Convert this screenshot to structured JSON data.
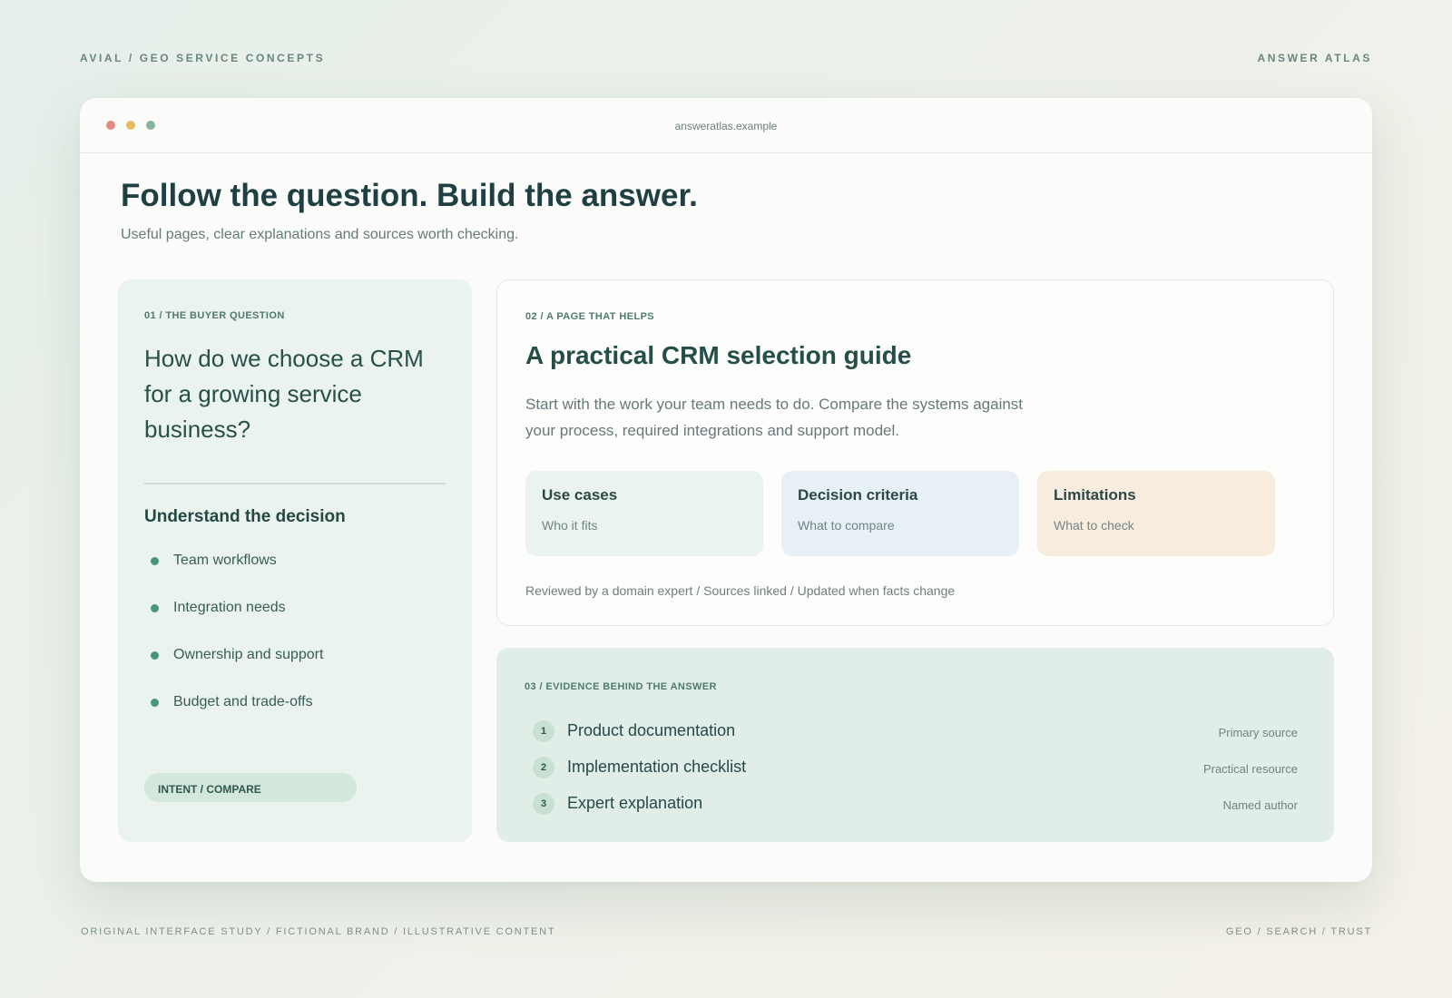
{
  "page": {
    "top_left": "AVIAL / GEO SERVICE CONCEPTS",
    "top_right": "ANSWER ATLAS",
    "bottom_left": "ORIGINAL INTERFACE STUDY / FICTIONAL BRAND / ILLUSTRATIVE CONTENT",
    "bottom_right": "GEO / SEARCH / TRUST"
  },
  "window": {
    "url": "answeratlas.example"
  },
  "hero": {
    "title": "Follow the question. Build the answer.",
    "subtitle": "Useful pages, clear explanations and sources worth checking."
  },
  "question_panel": {
    "eyebrow": "01 / THE BUYER QUESTION",
    "question": "How do we choose a CRM for a growing service business?",
    "section_title": "Understand the decision",
    "items": [
      {
        "label": "Team workflows"
      },
      {
        "label": "Integration needs"
      },
      {
        "label": "Ownership and support"
      },
      {
        "label": "Budget and trade-offs"
      }
    ],
    "pill": "INTENT / COMPARE"
  },
  "guide_panel": {
    "eyebrow": "02 / A PAGE THAT HELPS",
    "title": "A practical CRM selection guide",
    "description": "Start with the work your team needs to do. Compare the systems against your process, required integrations and support model.",
    "cards": [
      {
        "title": "Use cases",
        "subtitle": "Who it fits",
        "color": "#ebf3ee"
      },
      {
        "title": "Decision criteria",
        "subtitle": "What to compare",
        "color": "#e8f0f7"
      },
      {
        "title": "Limitations",
        "subtitle": "What to check",
        "color": "#f8ecdf"
      }
    ],
    "footnote": "Reviewed by a domain expert / Sources linked / Updated when facts change"
  },
  "evidence_panel": {
    "eyebrow": "03 / EVIDENCE BEHIND THE ANSWER",
    "items": [
      {
        "num": "1",
        "title": "Product documentation",
        "tag": "Primary source"
      },
      {
        "num": "2",
        "title": "Implementation checklist",
        "tag": "Practical resource"
      },
      {
        "num": "3",
        "title": "Expert explanation",
        "tag": "Named author"
      }
    ]
  },
  "colors": {
    "window_dot_red": "#e58a80",
    "window_dot_yellow": "#e7bc5f",
    "window_dot_green": "#86b49e",
    "accent_green": "#4a9479",
    "heading": "#1f3f43"
  }
}
